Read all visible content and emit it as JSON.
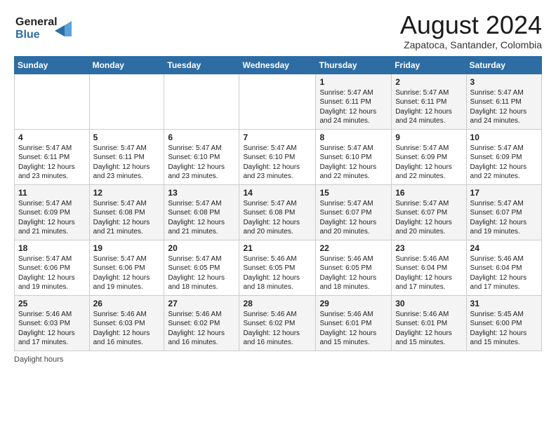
{
  "header": {
    "logo_line1": "General",
    "logo_line2": "Blue",
    "main_title": "August 2024",
    "subtitle": "Zapatoca, Santander, Colombia"
  },
  "weekdays": [
    "Sunday",
    "Monday",
    "Tuesday",
    "Wednesday",
    "Thursday",
    "Friday",
    "Saturday"
  ],
  "footer_label": "Daylight hours",
  "weeks": [
    [
      {
        "day": "",
        "info": ""
      },
      {
        "day": "",
        "info": ""
      },
      {
        "day": "",
        "info": ""
      },
      {
        "day": "",
        "info": ""
      },
      {
        "day": "1",
        "info": "Sunrise: 5:47 AM\nSunset: 6:11 PM\nDaylight: 12 hours\nand 24 minutes."
      },
      {
        "day": "2",
        "info": "Sunrise: 5:47 AM\nSunset: 6:11 PM\nDaylight: 12 hours\nand 24 minutes."
      },
      {
        "day": "3",
        "info": "Sunrise: 5:47 AM\nSunset: 6:11 PM\nDaylight: 12 hours\nand 24 minutes."
      }
    ],
    [
      {
        "day": "4",
        "info": "Sunrise: 5:47 AM\nSunset: 6:11 PM\nDaylight: 12 hours\nand 23 minutes."
      },
      {
        "day": "5",
        "info": "Sunrise: 5:47 AM\nSunset: 6:11 PM\nDaylight: 12 hours\nand 23 minutes."
      },
      {
        "day": "6",
        "info": "Sunrise: 5:47 AM\nSunset: 6:10 PM\nDaylight: 12 hours\nand 23 minutes."
      },
      {
        "day": "7",
        "info": "Sunrise: 5:47 AM\nSunset: 6:10 PM\nDaylight: 12 hours\nand 23 minutes."
      },
      {
        "day": "8",
        "info": "Sunrise: 5:47 AM\nSunset: 6:10 PM\nDaylight: 12 hours\nand 22 minutes."
      },
      {
        "day": "9",
        "info": "Sunrise: 5:47 AM\nSunset: 6:09 PM\nDaylight: 12 hours\nand 22 minutes."
      },
      {
        "day": "10",
        "info": "Sunrise: 5:47 AM\nSunset: 6:09 PM\nDaylight: 12 hours\nand 22 minutes."
      }
    ],
    [
      {
        "day": "11",
        "info": "Sunrise: 5:47 AM\nSunset: 6:09 PM\nDaylight: 12 hours\nand 21 minutes."
      },
      {
        "day": "12",
        "info": "Sunrise: 5:47 AM\nSunset: 6:08 PM\nDaylight: 12 hours\nand 21 minutes."
      },
      {
        "day": "13",
        "info": "Sunrise: 5:47 AM\nSunset: 6:08 PM\nDaylight: 12 hours\nand 21 minutes."
      },
      {
        "day": "14",
        "info": "Sunrise: 5:47 AM\nSunset: 6:08 PM\nDaylight: 12 hours\nand 20 minutes."
      },
      {
        "day": "15",
        "info": "Sunrise: 5:47 AM\nSunset: 6:07 PM\nDaylight: 12 hours\nand 20 minutes."
      },
      {
        "day": "16",
        "info": "Sunrise: 5:47 AM\nSunset: 6:07 PM\nDaylight: 12 hours\nand 20 minutes."
      },
      {
        "day": "17",
        "info": "Sunrise: 5:47 AM\nSunset: 6:07 PM\nDaylight: 12 hours\nand 19 minutes."
      }
    ],
    [
      {
        "day": "18",
        "info": "Sunrise: 5:47 AM\nSunset: 6:06 PM\nDaylight: 12 hours\nand 19 minutes."
      },
      {
        "day": "19",
        "info": "Sunrise: 5:47 AM\nSunset: 6:06 PM\nDaylight: 12 hours\nand 19 minutes."
      },
      {
        "day": "20",
        "info": "Sunrise: 5:47 AM\nSunset: 6:05 PM\nDaylight: 12 hours\nand 18 minutes."
      },
      {
        "day": "21",
        "info": "Sunrise: 5:46 AM\nSunset: 6:05 PM\nDaylight: 12 hours\nand 18 minutes."
      },
      {
        "day": "22",
        "info": "Sunrise: 5:46 AM\nSunset: 6:05 PM\nDaylight: 12 hours\nand 18 minutes."
      },
      {
        "day": "23",
        "info": "Sunrise: 5:46 AM\nSunset: 6:04 PM\nDaylight: 12 hours\nand 17 minutes."
      },
      {
        "day": "24",
        "info": "Sunrise: 5:46 AM\nSunset: 6:04 PM\nDaylight: 12 hours\nand 17 minutes."
      }
    ],
    [
      {
        "day": "25",
        "info": "Sunrise: 5:46 AM\nSunset: 6:03 PM\nDaylight: 12 hours\nand 17 minutes."
      },
      {
        "day": "26",
        "info": "Sunrise: 5:46 AM\nSunset: 6:03 PM\nDaylight: 12 hours\nand 16 minutes."
      },
      {
        "day": "27",
        "info": "Sunrise: 5:46 AM\nSunset: 6:02 PM\nDaylight: 12 hours\nand 16 minutes."
      },
      {
        "day": "28",
        "info": "Sunrise: 5:46 AM\nSunset: 6:02 PM\nDaylight: 12 hours\nand 16 minutes."
      },
      {
        "day": "29",
        "info": "Sunrise: 5:46 AM\nSunset: 6:01 PM\nDaylight: 12 hours\nand 15 minutes."
      },
      {
        "day": "30",
        "info": "Sunrise: 5:46 AM\nSunset: 6:01 PM\nDaylight: 12 hours\nand 15 minutes."
      },
      {
        "day": "31",
        "info": "Sunrise: 5:45 AM\nSunset: 6:00 PM\nDaylight: 12 hours\nand 15 minutes."
      }
    ]
  ]
}
